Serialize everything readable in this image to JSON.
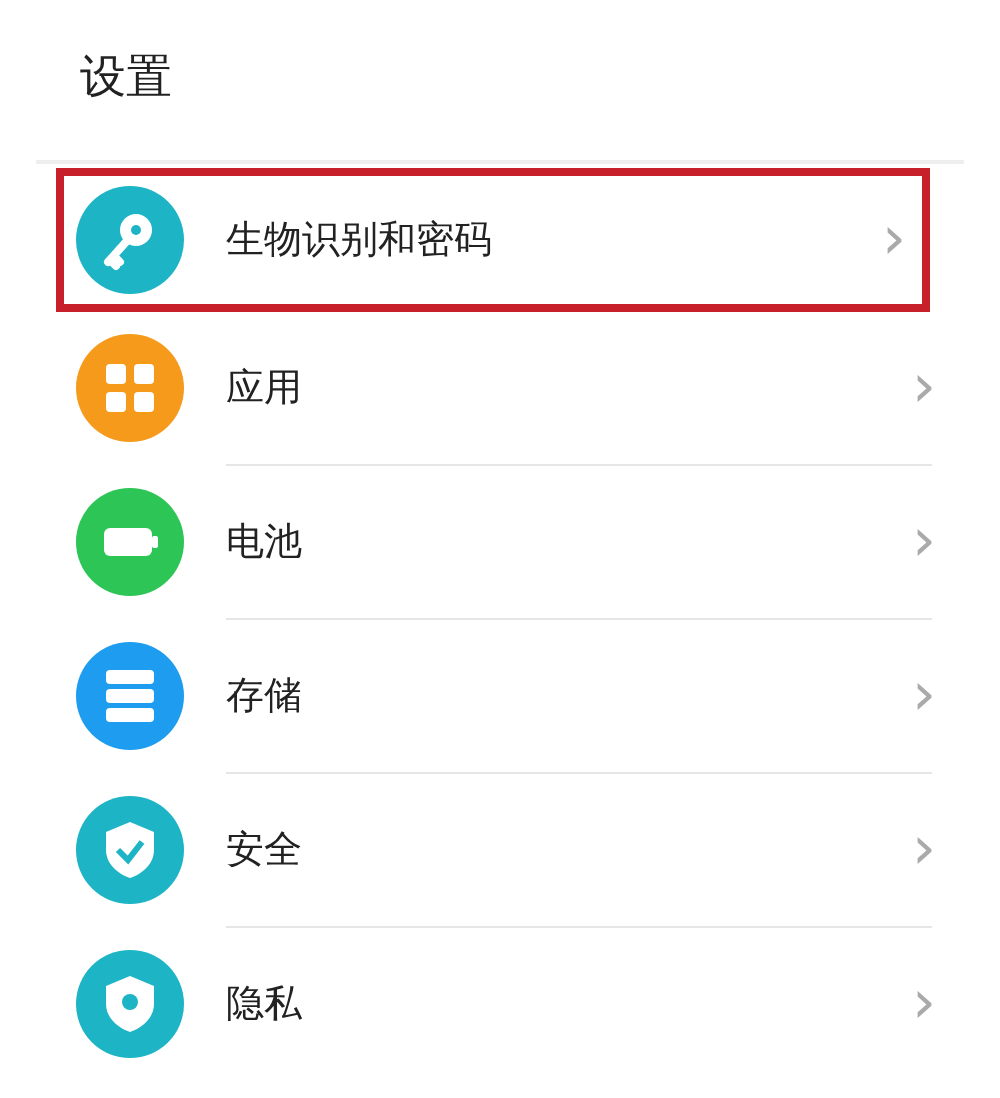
{
  "title": "设置",
  "items": [
    {
      "label": "生物识别和密码",
      "kind": "key",
      "color": "#1db4c6",
      "highlighted": true,
      "chevron": "›"
    },
    {
      "label": "应用",
      "kind": "apps",
      "color": "#f59a1b",
      "highlighted": false,
      "chevron": "›"
    },
    {
      "label": "电池",
      "kind": "battery",
      "color": "#2dc556",
      "highlighted": false,
      "chevron": "›"
    },
    {
      "label": "存储",
      "kind": "storage",
      "color": "#1e9cf0",
      "highlighted": false,
      "chevron": "›"
    },
    {
      "label": "安全",
      "kind": "shield",
      "color": "#1db4c6",
      "highlighted": false,
      "chevron": "›"
    },
    {
      "label": "隐私",
      "kind": "privacy",
      "color": "#1db4c6",
      "highlighted": false,
      "chevron": "›"
    }
  ]
}
